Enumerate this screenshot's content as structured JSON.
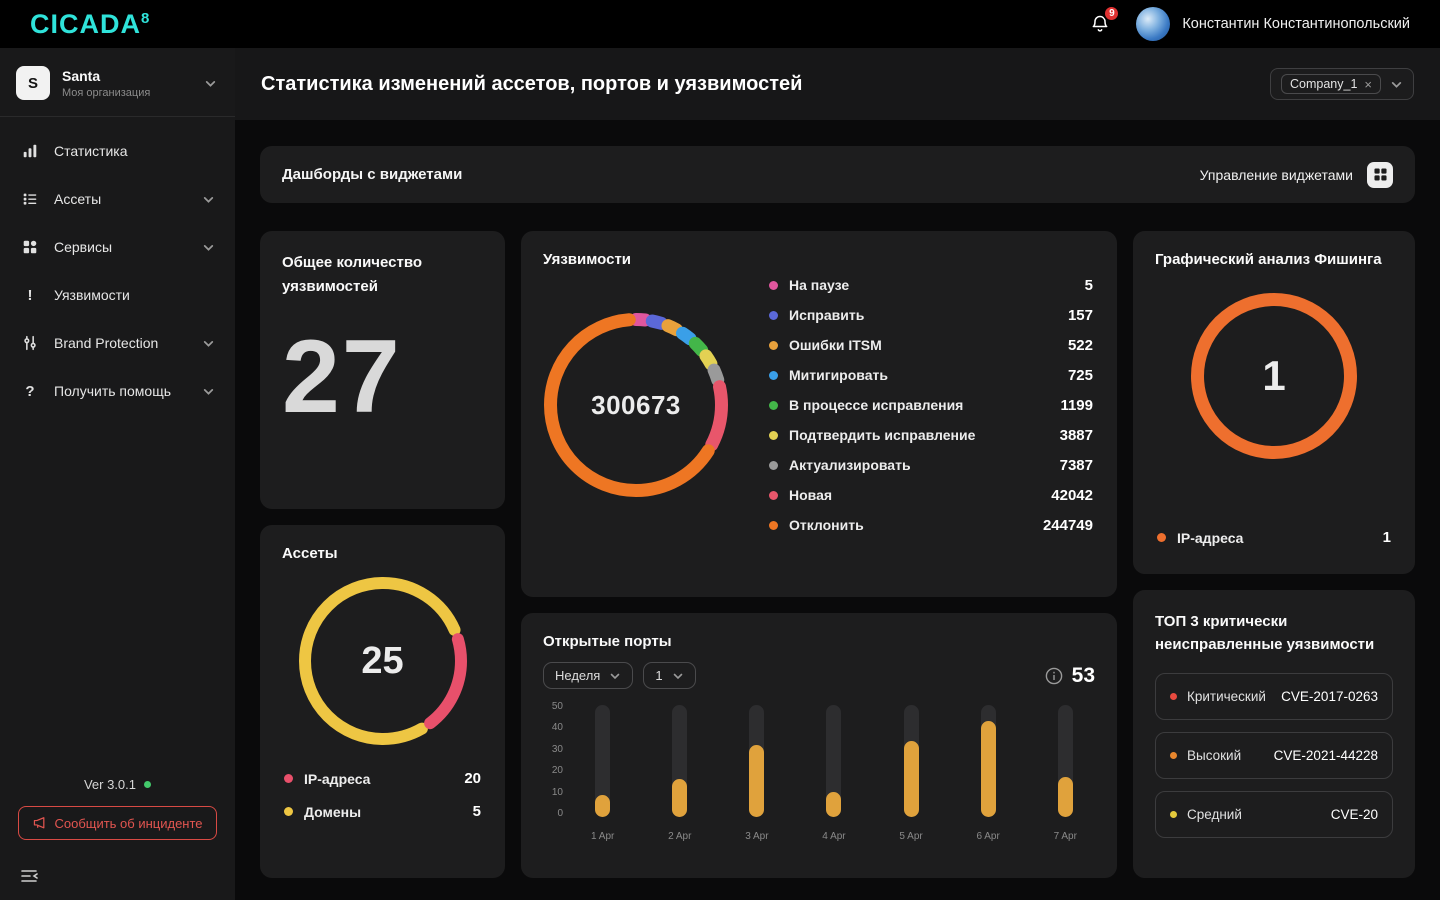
{
  "topbar": {
    "logo_text": "CICADA",
    "logo_sup": "8",
    "notification_count": "9",
    "user_name": "Константин Константинопольский"
  },
  "sidebar": {
    "org_initial": "S",
    "org_name": "Santa",
    "org_subtitle": "Моя организация",
    "items": [
      {
        "label": "Статистика"
      },
      {
        "label": "Ассеты"
      },
      {
        "label": "Сервисы"
      },
      {
        "label": "Уязвимости"
      },
      {
        "label": "Brand Protection"
      },
      {
        "label": "Получить помощь"
      }
    ],
    "version": "Ver 3.0.1",
    "report_incident": "Сообщить об инциденте"
  },
  "header": {
    "title": "Статистика изменений ассетов, портов и уязвимостей",
    "company_tag": "Company_1"
  },
  "widgets_bar": {
    "title": "Дашборды с виджетами",
    "manage": "Управление виджетами"
  },
  "cards": {
    "total": {
      "title": "Общее количество уязвимостей",
      "value": "27"
    },
    "assets": {
      "title": "Ассеты"
    },
    "vulns": {
      "title": "Уязвимости"
    },
    "ports": {
      "title": "Открытые порты",
      "period": "Неделя",
      "page": "1",
      "count": "53"
    },
    "phishing": {
      "title": "Графический анализ Фишинга"
    },
    "top3": {
      "title": "ТОП 3 критически неисправленные уязвимости",
      "items": [
        {
          "severity": "Критический",
          "cve": "CVE-2017-0263",
          "color": "#e84a3f"
        },
        {
          "severity": "Высокий",
          "cve": "CVE-2021-44228",
          "color": "#e8862d"
        },
        {
          "severity": "Средний",
          "cve": "CVE-20",
          "color": "#e3c93c"
        }
      ]
    }
  },
  "chart_data": [
    {
      "id": "vulns-donut",
      "type": "pie",
      "title": "Уязвимости",
      "center": "300673",
      "segments": [
        {
          "label": "На паузе",
          "value": 5,
          "color": "#e0569e"
        },
        {
          "label": "Исправить",
          "value": 157,
          "color": "#5b68d8"
        },
        {
          "label": "Ошибки ITSM",
          "value": 522,
          "color": "#e8a13c"
        },
        {
          "label": "Митигировать",
          "value": 725,
          "color": "#3a9fe8"
        },
        {
          "label": "В процессе исправления",
          "value": 1199,
          "color": "#43b649"
        },
        {
          "label": "Подтвердить исправление",
          "value": 3887,
          "color": "#e3d153"
        },
        {
          "label": "Актуализировать",
          "value": 7387,
          "color": "#9a9a9a"
        },
        {
          "label": "Новая",
          "value": 42042,
          "color": "#e8566b"
        },
        {
          "label": "Отклонить",
          "value": 244749,
          "color": "#ee7623"
        }
      ],
      "display": {
        "rotation": 0,
        "gap": 0.013,
        "min_frac": 0.022
      }
    },
    {
      "id": "assets-donut",
      "type": "pie",
      "title": "Ассеты",
      "center": "25",
      "segments": [
        {
          "label": "IP-адреса",
          "value": 20,
          "color": "#e8506b"
        },
        {
          "label": "Домены",
          "value": 5,
          "color": "#eec643"
        }
      ],
      "display": {
        "rotation": 150,
        "gap": 0.02,
        "arc_fracs": [
          0.8,
          0.2
        ],
        "arc_colors": [
          "#eec643",
          "#e8506b"
        ]
      }
    },
    {
      "id": "phishing-donut",
      "type": "pie",
      "title": "Графический анализ Фишинга",
      "center": "1",
      "segments": [
        {
          "label": "IP-адреса",
          "value": 1,
          "color": "#ee6f2e"
        }
      ],
      "display": {
        "rotation": 0,
        "gap": 0
      }
    },
    {
      "id": "ports-bars",
      "type": "bar",
      "title": "Открытые порты",
      "categories": [
        "1 Apr",
        "2 Apr",
        "3 Apr",
        "4 Apr",
        "5 Apr",
        "6 Apr",
        "7 Apr"
      ],
      "values": [
        10,
        17,
        32,
        11,
        34,
        43,
        18
      ],
      "ylim": [
        0,
        50
      ],
      "yticks": [
        0,
        10,
        20,
        30,
        40,
        50
      ],
      "bar_color": "#e0a23c",
      "track_color": "#2d2d2f"
    }
  ]
}
